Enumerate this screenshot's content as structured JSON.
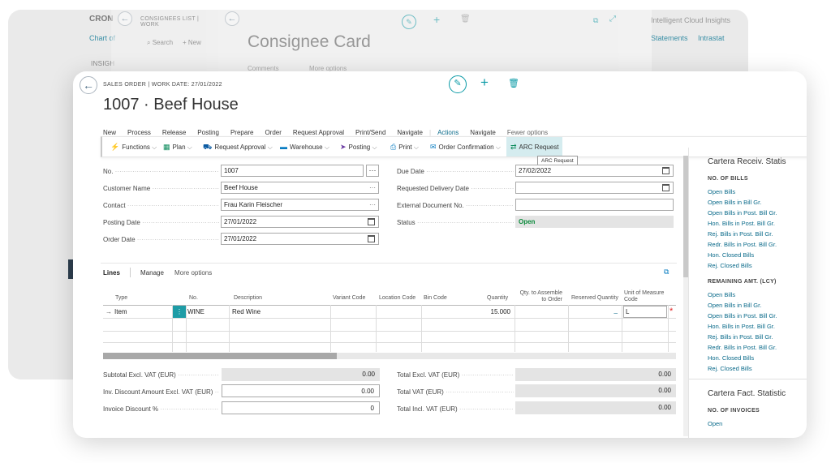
{
  "bg1": {
    "title": "CRON",
    "link": "Chart of",
    "label": "INSIGH",
    "right_title": "Intelligent Cloud Insights",
    "right_links": [
      "Statements",
      "Intrastat"
    ]
  },
  "bg2": {
    "breadcrumb": "CONSIGNEES LIST | WORK",
    "search": "Search",
    "new": "New"
  },
  "bg3": {
    "title": "Consignee Card",
    "comments": "Comments",
    "more": "More options"
  },
  "header": {
    "breadcrumb": "SALES ORDER | WORK DATE: 27/01/2022",
    "title": "1007 · Beef House"
  },
  "menu": [
    "New",
    "Process",
    "Release",
    "Posting",
    "Prepare",
    "Order",
    "Request Approval",
    "Print/Send",
    "Navigate",
    "Actions",
    "Navigate",
    "Fewer options"
  ],
  "actions": [
    {
      "label": "Functions",
      "icon": "bolt-icon"
    },
    {
      "label": "Plan",
      "icon": "plan-icon"
    },
    {
      "label": "Request Approval",
      "icon": "approval-icon"
    },
    {
      "label": "Warehouse",
      "icon": "warehouse-icon"
    },
    {
      "label": "Posting",
      "icon": "posting-icon"
    },
    {
      "label": "Print",
      "icon": "print-icon"
    },
    {
      "label": "Order Confirmation",
      "icon": "email-icon"
    },
    {
      "label": "ARC Request",
      "icon": "arc-icon"
    }
  ],
  "tooltip": "ARC Request",
  "general": {
    "no_label": "No.",
    "no_value": "1007",
    "customer_label": "Customer Name",
    "customer_value": "Beef House",
    "contact_label": "Contact",
    "contact_value": "Frau Karin Fleischer",
    "posting_label": "Posting Date",
    "posting_value": "27/01/2022",
    "order_label": "Order Date",
    "order_value": "27/01/2022",
    "due_label": "Due Date",
    "due_value": "27/02/2022",
    "req_label": "Requested Delivery Date",
    "req_value": "",
    "ext_label": "External Document No.",
    "ext_value": "",
    "status_label": "Status",
    "status_value": "Open"
  },
  "lines": {
    "tab_lines": "Lines",
    "tab_manage": "Manage",
    "tab_more": "More options",
    "headers": [
      "Type",
      "No.",
      "Description",
      "Variant Code",
      "Location Code",
      "Bin Code",
      "Quantity",
      "Qty. to Assemble to Order",
      "Reserved Quantity",
      "Unit of Measure Code"
    ],
    "row": {
      "type": "Item",
      "no": "WINE",
      "desc": "Red Wine",
      "qty": "15.000",
      "reserved": "_",
      "uom": "L"
    }
  },
  "totals": {
    "subtotal_label": "Subtotal Excl. VAT (EUR)",
    "subtotal_value": "0.00",
    "invdisc_label": "Inv. Discount Amount Excl. VAT (EUR)",
    "invdisc_value": "0.00",
    "invpct_label": "Invoice Discount %",
    "invpct_value": "0",
    "totexcl_label": "Total Excl. VAT (EUR)",
    "totexcl_value": "0.00",
    "totvat_label": "Total VAT (EUR)",
    "totvat_value": "0.00",
    "totincl_label": "Total Incl. VAT (EUR)",
    "totincl_value": "0.00"
  },
  "factbox": {
    "title1": "Cartera Receiv. Statis",
    "sub1": "NO. OF BILLS",
    "items1": [
      "Open Bills",
      "Open Bills in Bill Gr.",
      "Open Bills in Post. Bill Gr.",
      "Hon. Bills in Post. Bill Gr.",
      "Rej. Bills in Post. Bill Gr.",
      "Redr. Bills in Post. Bill Gr.",
      "Hon. Closed Bills",
      "Rej. Closed Bills"
    ],
    "sub2": "REMAINING AMT. (LCY)",
    "items2": [
      "Open Bills",
      "Open Bills in Bill Gr.",
      "Open Bills in Post. Bill Gr.",
      "Hon. Bills in Post. Bill Gr.",
      "Rej. Bills in Post. Bill Gr.",
      "Redr. Bills in Post. Bill Gr.",
      "Hon. Closed Bills",
      "Rej. Closed Bills"
    ],
    "title2": "Cartera Fact. Statistic",
    "sub3": "NO. OF INVOICES",
    "items3": [
      "Open"
    ]
  },
  "colors": {
    "accent": "#008489",
    "status": "#0a8a3a",
    "highlight": "#d5ecef"
  }
}
